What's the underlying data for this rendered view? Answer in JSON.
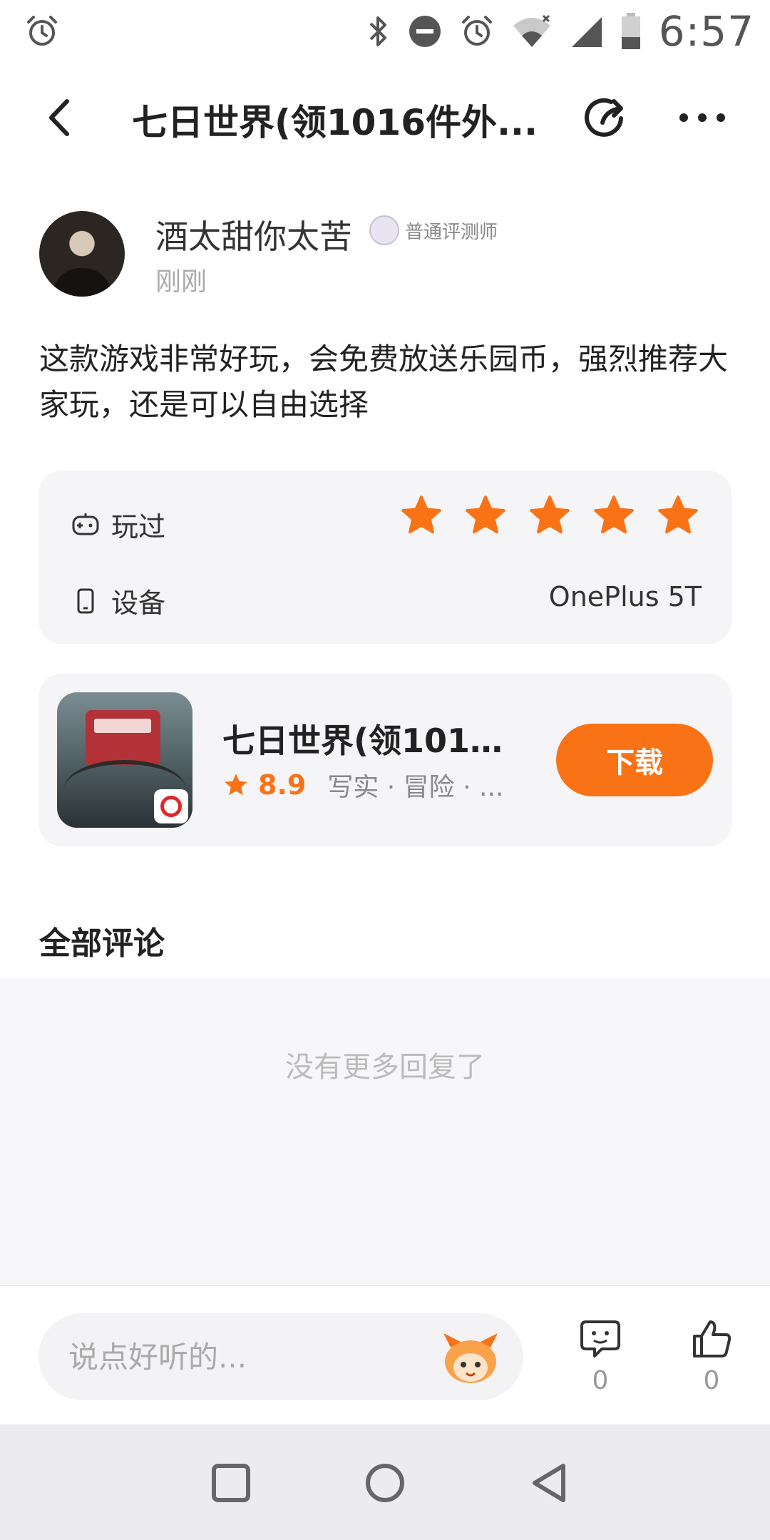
{
  "status_bar": {
    "time": "6:57",
    "icons": [
      "alarm-icon",
      "bluetooth-icon",
      "do-not-disturb-icon",
      "alarm-icon",
      "wifi-icon",
      "cell-signal-icon",
      "battery-icon"
    ]
  },
  "header": {
    "title": "七日世界(领1016件外...",
    "icons": [
      "back-icon",
      "share-icon",
      "more-icon"
    ]
  },
  "author": {
    "name": "酒太甜你太苦",
    "badge": "普通评测师",
    "time": "刚刚"
  },
  "review": {
    "text": "这款游戏非常好玩，会免费放送乐园币，强烈推荐大家玩，还是可以自由选择"
  },
  "info_card": {
    "played_label": "玩过",
    "rating_stars": 5,
    "star_color": "#f97316",
    "device_label": "设备",
    "device_value": "OnePlus 5T"
  },
  "game_card": {
    "name": "七日世界(领1016...",
    "rating": "8.9",
    "tags": "写实 · 冒险 · ...",
    "download_label": "下载",
    "accent": "#f97316"
  },
  "comments": {
    "title": "全部评论",
    "empty_text": "没有更多回复了"
  },
  "bottom_bar": {
    "input_placeholder": "说点好听的...",
    "comment_count": "0",
    "like_count": "0"
  },
  "nav_bar": {
    "icons": [
      "recent-apps-icon",
      "home-icon",
      "back-triangle-icon"
    ]
  }
}
